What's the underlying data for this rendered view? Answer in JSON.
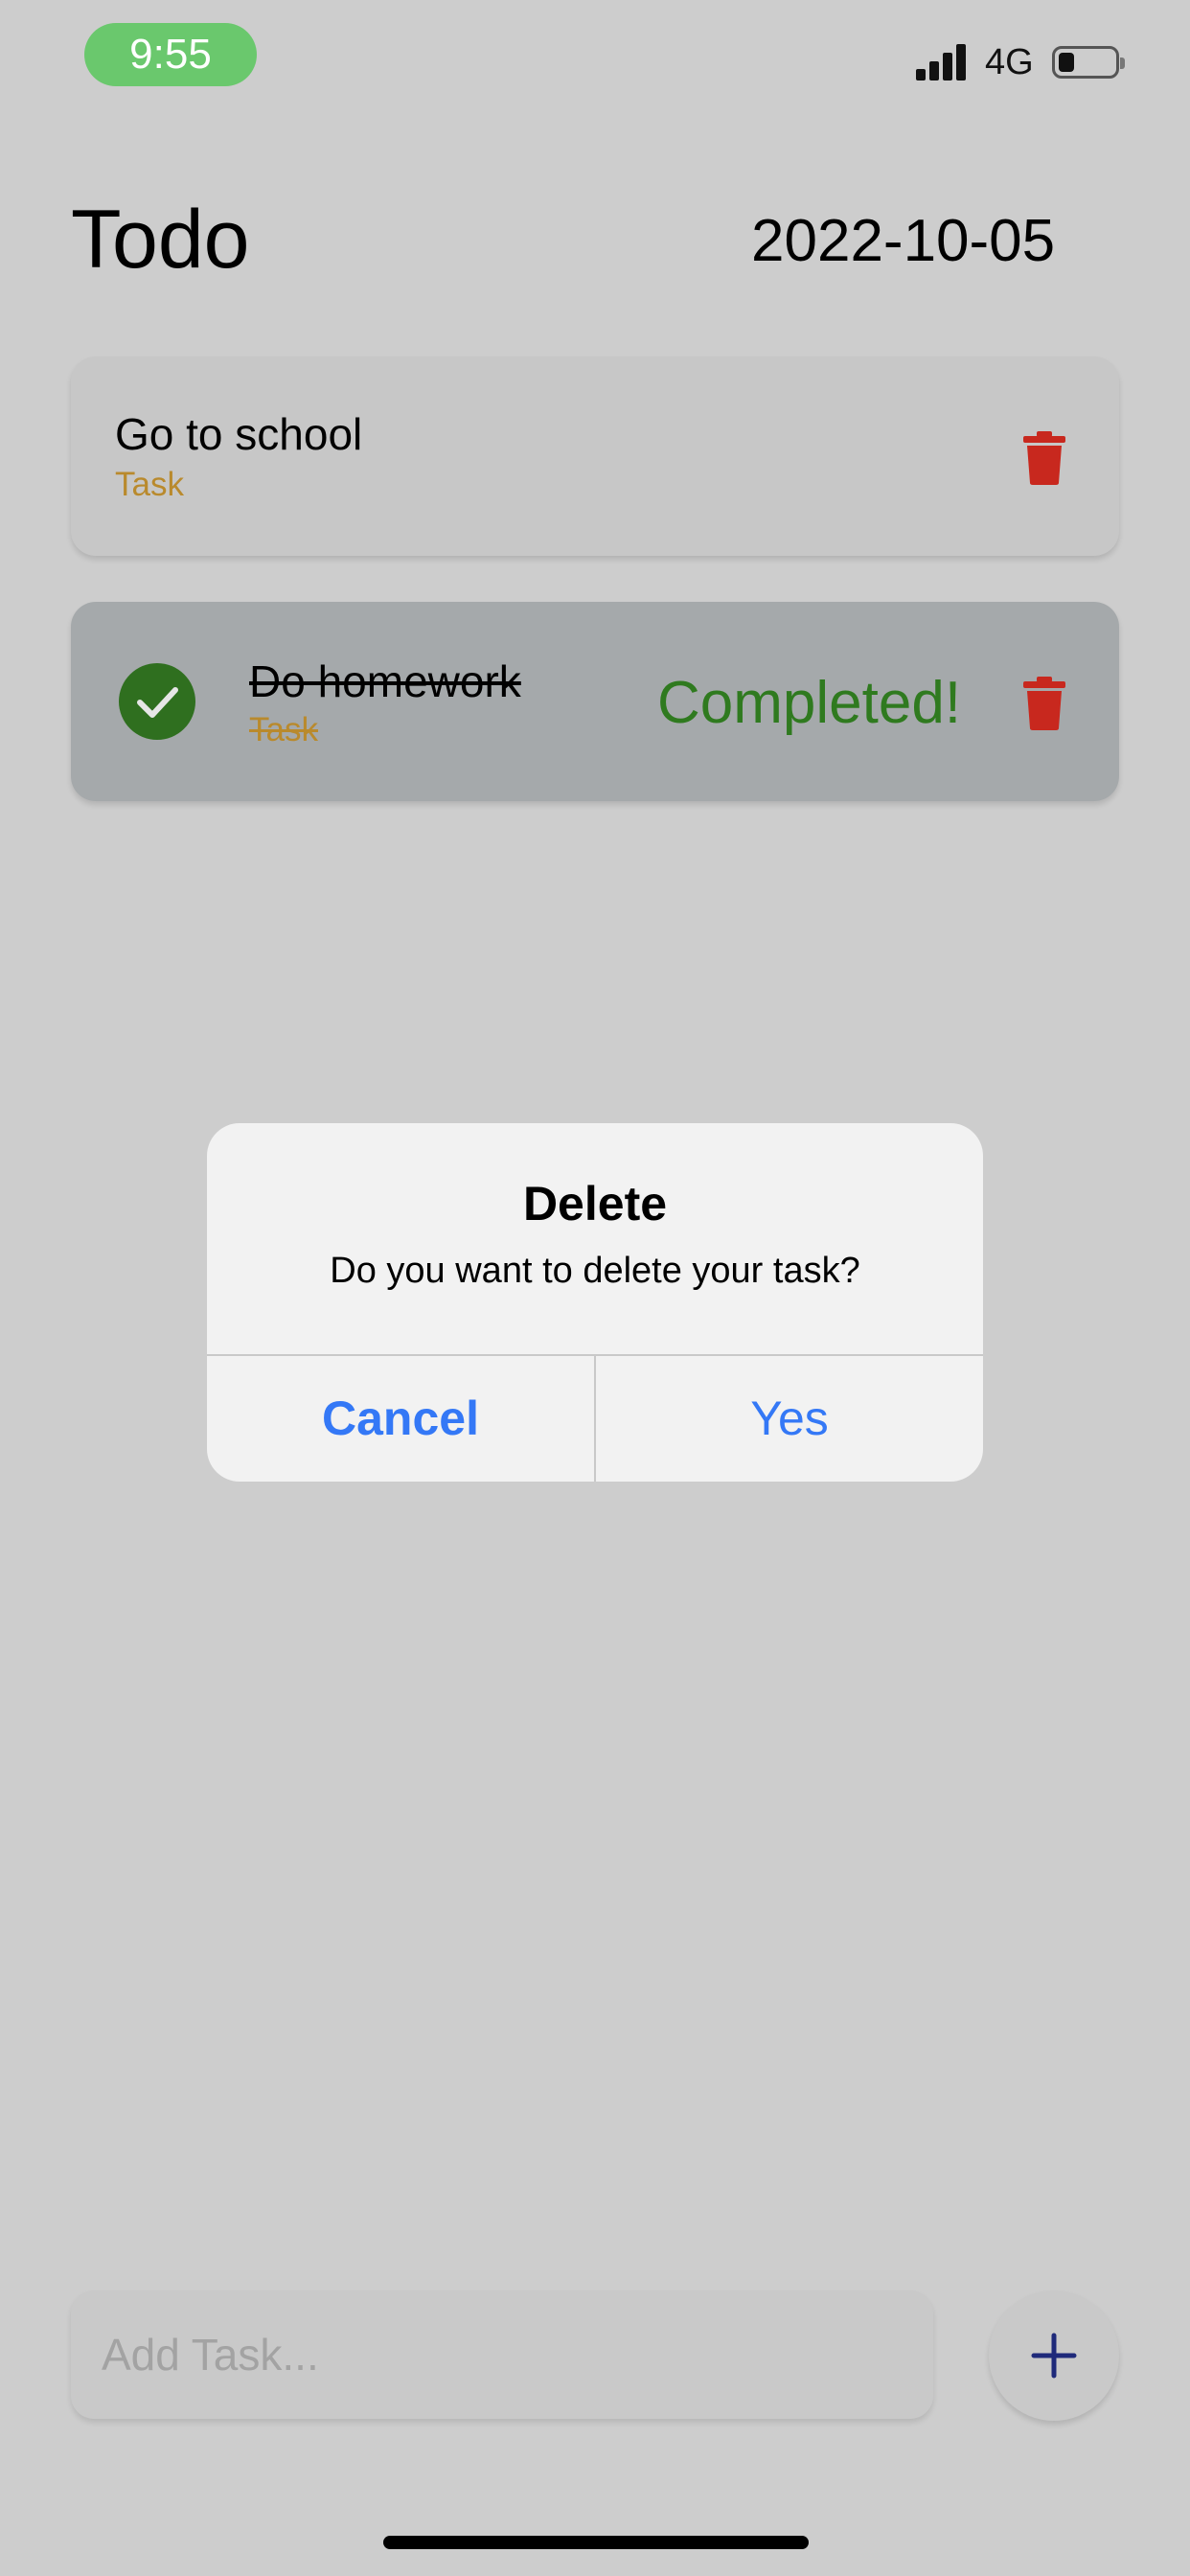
{
  "status_bar": {
    "time": "9:55",
    "network": "4G",
    "icons": [
      "signal-icon",
      "battery-icon"
    ]
  },
  "header": {
    "title": "Todo",
    "date": "2022-10-05"
  },
  "tasks": [
    {
      "name": "Go to school",
      "type": "Task",
      "completed": false
    },
    {
      "name": "Do homework",
      "type": "Task",
      "completed": true,
      "status_label": "Completed!"
    }
  ],
  "dialog": {
    "title": "Delete",
    "message": "Do you want to delete your task?",
    "cancel_label": "Cancel",
    "confirm_label": "Yes"
  },
  "input": {
    "placeholder": "Add Task...",
    "value": ""
  },
  "colors": {
    "accent": "#3478f6",
    "delete": "#c8281e",
    "completed": "#2f7a1f",
    "task_type": "#b98a2d",
    "time_pill": "#6ac86d",
    "add_icon": "#1f2a7a"
  }
}
